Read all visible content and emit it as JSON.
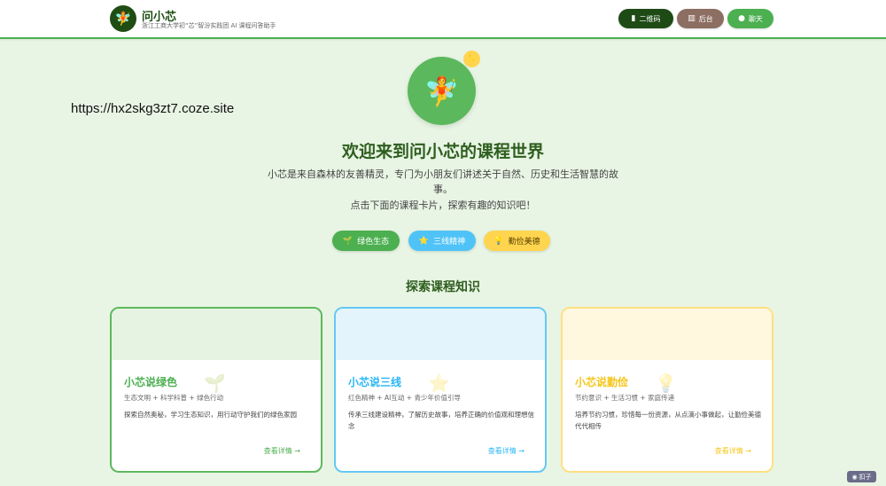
{
  "header": {
    "logo_icon": "fairy-icon",
    "title": "问小芯",
    "subtitle": "浙江工商大学初“芯”智汾实践团 AI 课程问答助手",
    "buttons": {
      "qr": {
        "icon": "▮",
        "label": "二维码"
      },
      "admin": {
        "icon": "▥",
        "label": "后台"
      },
      "chat": {
        "icon": "●",
        "label": "聊天"
      }
    }
  },
  "url_overlay": "https://hx2skg3zt7.coze.site",
  "hero": {
    "avatar_icon": "🧚",
    "sparkle_icon": "✨",
    "title": "欢迎来到问小芯的课程世界",
    "description": "小芯是来自森林的友善精灵，专门为小朋友们讲述关于自然、历史和生活智慧的故事。",
    "description2": "点击下面的课程卡片，探索有趣的知识吧！",
    "pills": [
      {
        "icon": "🌱",
        "label": "绿色生态"
      },
      {
        "icon": "⭐",
        "label": "三线精神"
      },
      {
        "icon": "💡",
        "label": "勤俭美德"
      }
    ]
  },
  "section": {
    "title": "探索课程知识"
  },
  "cards": [
    {
      "deco": "🌱",
      "title": "小芯说绿色",
      "tags": "生态文明 + 科学科普 + 绿色行动",
      "desc": "探索自然奥秘，学习生态知识，用行动守护我们的绿色家园",
      "link": "查看详情 →"
    },
    {
      "deco": "⭐",
      "title": "小芯说三线",
      "tags": "红色精神 + AI互动 + 青少年价值引导",
      "desc": "传承三线建设精神，了解历史故事，培养正确的价值观和理想信念",
      "link": "查看详情 →"
    },
    {
      "deco": "💡",
      "title": "小芯说勤俭",
      "tags": "节约意识 + 生活习惯 + 家庭传递",
      "desc": "培养节约习惯，珍惜每一份资源，从点滴小事做起，让勤俭美德代代相传",
      "link": "查看详情 →"
    }
  ],
  "corner_badge": {
    "icon": "◉",
    "label": "扣子"
  },
  "colors": {
    "primary_green": "#4caf50",
    "dark_green": "#1e4a16",
    "blue": "#29b6f6",
    "yellow": "#ffd54f",
    "brown": "#8d6e63",
    "background": "#e8f5e4"
  }
}
